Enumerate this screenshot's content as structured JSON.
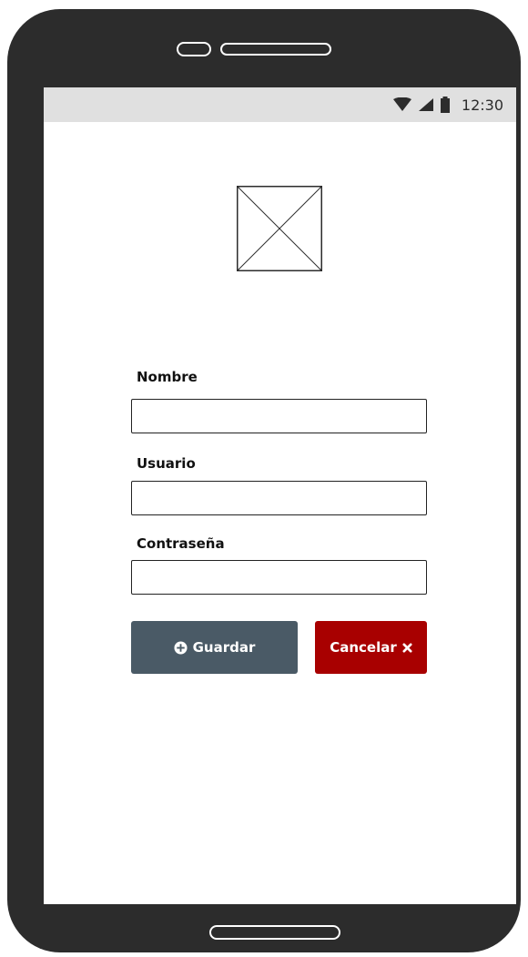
{
  "status_bar": {
    "time": "12:30",
    "icons": [
      "wifi-icon",
      "cellular-signal-icon",
      "battery-icon"
    ]
  },
  "form": {
    "image_placeholder_icon": "image-placeholder-icon",
    "fields": [
      {
        "label": "Nombre",
        "value": ""
      },
      {
        "label": "Usuario",
        "value": ""
      },
      {
        "label": "Contraseña",
        "value": ""
      }
    ],
    "save_label": "Guardar",
    "save_icon": "plus-circle-icon",
    "cancel_label": "Cancelar",
    "cancel_icon": "close-icon"
  },
  "colors": {
    "device_frame": "#2c2c2c",
    "status_bar_bg": "#e0e0e0",
    "save_button": "#4a5a66",
    "cancel_button": "#a80000"
  }
}
